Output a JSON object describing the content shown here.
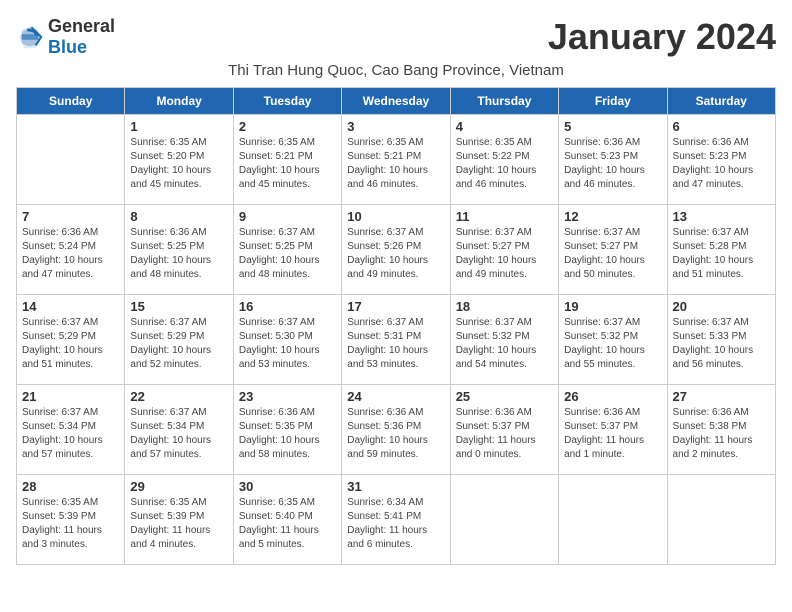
{
  "header": {
    "logo_general": "General",
    "logo_blue": "Blue",
    "title": "January 2024",
    "subtitle": "Thi Tran Hung Quoc, Cao Bang Province, Vietnam"
  },
  "days_of_week": [
    "Sunday",
    "Monday",
    "Tuesday",
    "Wednesday",
    "Thursday",
    "Friday",
    "Saturday"
  ],
  "weeks": [
    [
      {
        "day": "",
        "info": ""
      },
      {
        "day": "1",
        "info": "Sunrise: 6:35 AM\nSunset: 5:20 PM\nDaylight: 10 hours\nand 45 minutes."
      },
      {
        "day": "2",
        "info": "Sunrise: 6:35 AM\nSunset: 5:21 PM\nDaylight: 10 hours\nand 45 minutes."
      },
      {
        "day": "3",
        "info": "Sunrise: 6:35 AM\nSunset: 5:21 PM\nDaylight: 10 hours\nand 46 minutes."
      },
      {
        "day": "4",
        "info": "Sunrise: 6:35 AM\nSunset: 5:22 PM\nDaylight: 10 hours\nand 46 minutes."
      },
      {
        "day": "5",
        "info": "Sunrise: 6:36 AM\nSunset: 5:23 PM\nDaylight: 10 hours\nand 46 minutes."
      },
      {
        "day": "6",
        "info": "Sunrise: 6:36 AM\nSunset: 5:23 PM\nDaylight: 10 hours\nand 47 minutes."
      }
    ],
    [
      {
        "day": "7",
        "info": "Sunrise: 6:36 AM\nSunset: 5:24 PM\nDaylight: 10 hours\nand 47 minutes."
      },
      {
        "day": "8",
        "info": "Sunrise: 6:36 AM\nSunset: 5:25 PM\nDaylight: 10 hours\nand 48 minutes."
      },
      {
        "day": "9",
        "info": "Sunrise: 6:37 AM\nSunset: 5:25 PM\nDaylight: 10 hours\nand 48 minutes."
      },
      {
        "day": "10",
        "info": "Sunrise: 6:37 AM\nSunset: 5:26 PM\nDaylight: 10 hours\nand 49 minutes."
      },
      {
        "day": "11",
        "info": "Sunrise: 6:37 AM\nSunset: 5:27 PM\nDaylight: 10 hours\nand 49 minutes."
      },
      {
        "day": "12",
        "info": "Sunrise: 6:37 AM\nSunset: 5:27 PM\nDaylight: 10 hours\nand 50 minutes."
      },
      {
        "day": "13",
        "info": "Sunrise: 6:37 AM\nSunset: 5:28 PM\nDaylight: 10 hours\nand 51 minutes."
      }
    ],
    [
      {
        "day": "14",
        "info": "Sunrise: 6:37 AM\nSunset: 5:29 PM\nDaylight: 10 hours\nand 51 minutes."
      },
      {
        "day": "15",
        "info": "Sunrise: 6:37 AM\nSunset: 5:29 PM\nDaylight: 10 hours\nand 52 minutes."
      },
      {
        "day": "16",
        "info": "Sunrise: 6:37 AM\nSunset: 5:30 PM\nDaylight: 10 hours\nand 53 minutes."
      },
      {
        "day": "17",
        "info": "Sunrise: 6:37 AM\nSunset: 5:31 PM\nDaylight: 10 hours\nand 53 minutes."
      },
      {
        "day": "18",
        "info": "Sunrise: 6:37 AM\nSunset: 5:32 PM\nDaylight: 10 hours\nand 54 minutes."
      },
      {
        "day": "19",
        "info": "Sunrise: 6:37 AM\nSunset: 5:32 PM\nDaylight: 10 hours\nand 55 minutes."
      },
      {
        "day": "20",
        "info": "Sunrise: 6:37 AM\nSunset: 5:33 PM\nDaylight: 10 hours\nand 56 minutes."
      }
    ],
    [
      {
        "day": "21",
        "info": "Sunrise: 6:37 AM\nSunset: 5:34 PM\nDaylight: 10 hours\nand 57 minutes."
      },
      {
        "day": "22",
        "info": "Sunrise: 6:37 AM\nSunset: 5:34 PM\nDaylight: 10 hours\nand 57 minutes."
      },
      {
        "day": "23",
        "info": "Sunrise: 6:36 AM\nSunset: 5:35 PM\nDaylight: 10 hours\nand 58 minutes."
      },
      {
        "day": "24",
        "info": "Sunrise: 6:36 AM\nSunset: 5:36 PM\nDaylight: 10 hours\nand 59 minutes."
      },
      {
        "day": "25",
        "info": "Sunrise: 6:36 AM\nSunset: 5:37 PM\nDaylight: 11 hours\nand 0 minutes."
      },
      {
        "day": "26",
        "info": "Sunrise: 6:36 AM\nSunset: 5:37 PM\nDaylight: 11 hours\nand 1 minute."
      },
      {
        "day": "27",
        "info": "Sunrise: 6:36 AM\nSunset: 5:38 PM\nDaylight: 11 hours\nand 2 minutes."
      }
    ],
    [
      {
        "day": "28",
        "info": "Sunrise: 6:35 AM\nSunset: 5:39 PM\nDaylight: 11 hours\nand 3 minutes."
      },
      {
        "day": "29",
        "info": "Sunrise: 6:35 AM\nSunset: 5:39 PM\nDaylight: 11 hours\nand 4 minutes."
      },
      {
        "day": "30",
        "info": "Sunrise: 6:35 AM\nSunset: 5:40 PM\nDaylight: 11 hours\nand 5 minutes."
      },
      {
        "day": "31",
        "info": "Sunrise: 6:34 AM\nSunset: 5:41 PM\nDaylight: 11 hours\nand 6 minutes."
      },
      {
        "day": "",
        "info": ""
      },
      {
        "day": "",
        "info": ""
      },
      {
        "day": "",
        "info": ""
      }
    ]
  ]
}
